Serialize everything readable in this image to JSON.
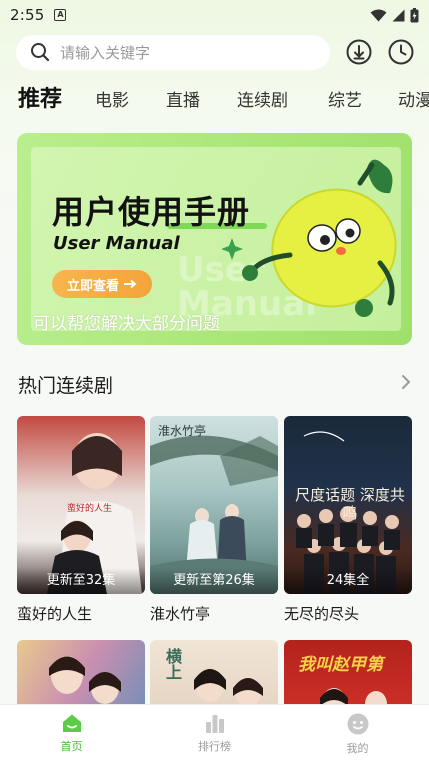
{
  "status_bar": {
    "time": "2:55",
    "notif_letter": "A"
  },
  "search": {
    "placeholder": "请输入关键字"
  },
  "tabs": [
    "推荐",
    "电影",
    "直播",
    "连续剧",
    "综艺",
    "动漫"
  ],
  "banner": {
    "title": "用户使用手册",
    "subtitle": "User Manual",
    "button_label": "立即查看",
    "caption": "可以帮您解决大部分问题",
    "watermark": "User Manual"
  },
  "section": {
    "title": "热门连续剧"
  },
  "shows": [
    {
      "title": "蛮好的人生",
      "episodes": "更新至32集",
      "poster_text": "蛮好的人生"
    },
    {
      "title": "淮水竹亭",
      "episodes": "更新至第26集",
      "poster_text": "淮水竹亭"
    },
    {
      "title": "无尽的尽头",
      "episodes": "24集全",
      "poster_text": "尺度话题 深度共鸣"
    }
  ],
  "shows_row2": [
    {
      "poster_text": ""
    },
    {
      "poster_text": "横上"
    },
    {
      "poster_text": "我叫赵甲第"
    }
  ],
  "bottom_nav": [
    {
      "label": "首页",
      "icon": "home-icon",
      "active": true
    },
    {
      "label": "排行榜",
      "icon": "chart-icon",
      "active": false
    },
    {
      "label": "我的",
      "icon": "profile-icon",
      "active": false
    }
  ],
  "colors": {
    "accent": "#4cb83a",
    "banner_green": "#b9ee8e",
    "button_orange": "#f4a43a"
  }
}
